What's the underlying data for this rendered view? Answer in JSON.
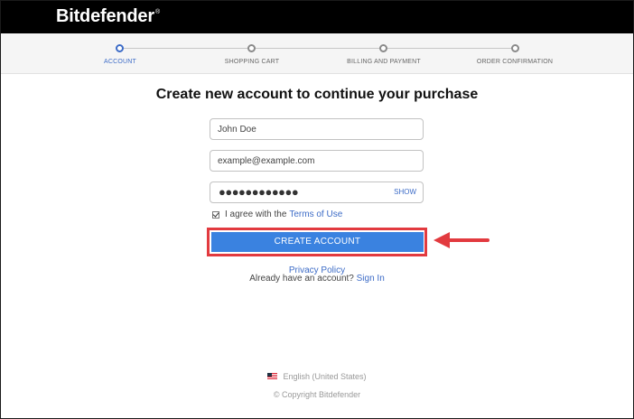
{
  "brand": {
    "name": "Bitdefender",
    "trademark": "®"
  },
  "steps": [
    {
      "label": "ACCOUNT",
      "active": true
    },
    {
      "label": "SHOPPING CART",
      "active": false
    },
    {
      "label": "BILLING AND PAYMENT",
      "active": false
    },
    {
      "label": "ORDER CONFIRMATION",
      "active": false
    }
  ],
  "form": {
    "heading": "Create new account to continue your purchase",
    "name_placeholder": "John Doe",
    "email_placeholder": "example@example.com",
    "password_masked": "●●●●●●●●●●●●",
    "show_label": "SHOW",
    "agree_text": "I agree with the",
    "terms_link": "Terms of Use",
    "agree_checked": true,
    "create_label": "CREATE ACCOUNT"
  },
  "links": {
    "privacy": "Privacy Policy",
    "have_account": "Already have an account?",
    "sign_in": "Sign In"
  },
  "footer": {
    "language": "English (United States)",
    "copyright": "© Copyright Bitdefender"
  },
  "colors": {
    "accent": "#3d6cc7",
    "button": "#3a82e0",
    "highlight": "#e23a3f"
  },
  "icons": [
    "checkbox-icon",
    "us-flag-icon",
    "red-arrow-icon"
  ]
}
